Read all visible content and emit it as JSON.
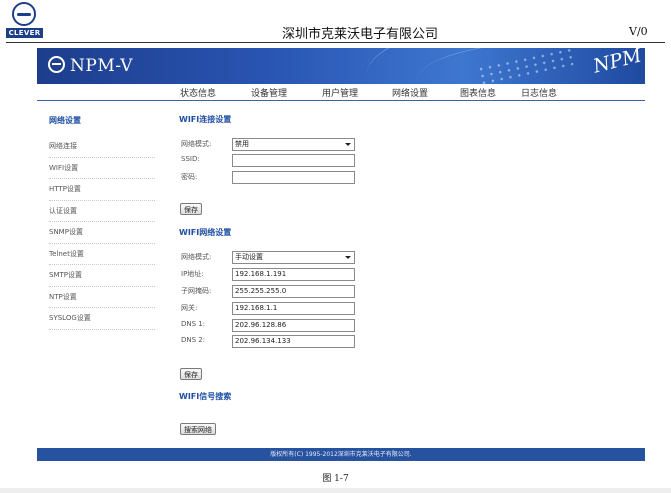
{
  "document": {
    "logo_text": "CLEVER",
    "company": "深圳市克莱沃电子有限公司",
    "version": "V/0",
    "figure_caption": "图 1-7"
  },
  "app": {
    "title": "NPM-V",
    "banner_mark": "NPM",
    "nav": [
      "状态信息",
      "设备管理",
      "用户管理",
      "网络设置",
      "图表信息",
      "日志信息"
    ],
    "footer": "版权所有(C) 1995-2012深圳市克莱沃电子有限公司."
  },
  "sidebar": {
    "title": "网络设置",
    "items": [
      "网络连接",
      "WIFI设置",
      "HTTP设置",
      "认证设置",
      "SNMP设置",
      "Telnet设置",
      "SMTP设置",
      "NTP设置",
      "SYSLOG设置"
    ]
  },
  "wifi_connect": {
    "title": "WIFI连接设置",
    "mode_label": "网络模式:",
    "mode_value": "禁用",
    "ssid_label": "SSID:",
    "ssid_value": "",
    "password_label": "密码:",
    "password_value": "",
    "save_label": "保存"
  },
  "wifi_network": {
    "title": "WIFI网络设置",
    "mode_label": "网络模式:",
    "mode_value": "手动设置",
    "ip_label": "IP地址:",
    "ip_value": "192.168.1.191",
    "mask_label": "子网掩码:",
    "mask_value": "255.255.255.0",
    "gateway_label": "网关:",
    "gateway_value": "192.168.1.1",
    "dns1_label": "DNS 1:",
    "dns1_value": "202.96.128.86",
    "dns2_label": "DNS 2:",
    "dns2_value": "202.96.134.133",
    "save_label": "保存"
  },
  "wifi_search": {
    "title": "WIFI信号搜索",
    "search_label": "搜索网络"
  }
}
